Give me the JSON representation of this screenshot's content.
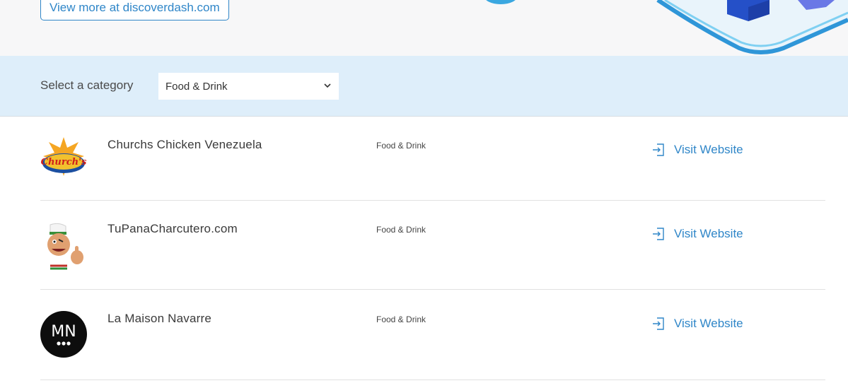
{
  "hero": {
    "view_more_label": "View more at discoverdash.com"
  },
  "filter": {
    "label": "Select a category",
    "selected": "Food & Drink"
  },
  "listings": [
    {
      "name": "Churchs Chicken Venezuela",
      "category": "Food & Drink",
      "visit_label": "Visit Website",
      "logo_icon": "churchs-chicken-logo",
      "logo_text": "Church's"
    },
    {
      "name": "TuPanaCharcutero.com",
      "category": "Food & Drink",
      "visit_label": "Visit Website",
      "logo_icon": "charcutero-mascot-logo"
    },
    {
      "name": "La Maison Navarre",
      "category": "Food & Drink",
      "visit_label": "Visit Website",
      "logo_icon": "mn-monogram-logo",
      "logo_text": "MN"
    }
  ],
  "colors": {
    "accent": "#2f86c8",
    "filter_bg": "#deeefa",
    "hero_bg": "#f7f7f8"
  }
}
